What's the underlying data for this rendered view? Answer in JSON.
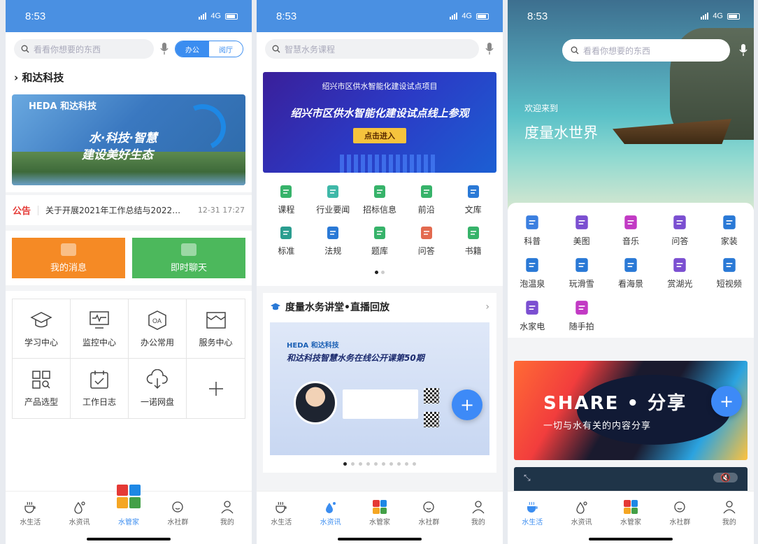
{
  "status_bar": {
    "time": "8:53",
    "network": "4G"
  },
  "tabbar": [
    {
      "label": "水生活",
      "icon": "coffee-cup-icon"
    },
    {
      "label": "水资讯",
      "icon": "water-drops-icon"
    },
    {
      "label": "水管家",
      "icon": "manager-tiles-icon"
    },
    {
      "label": "水社群",
      "icon": "chat-bubble-icon"
    },
    {
      "label": "我的",
      "icon": "person-icon"
    }
  ],
  "colors": {
    "accent": "#3b8df0",
    "orange": "#f58a25",
    "green": "#4cb85c",
    "alert": "#e53935"
  },
  "screen1": {
    "search_placeholder": "看看你想要的东西",
    "segment": [
      "办公",
      "阅厅"
    ],
    "company": "和达科技",
    "banner": {
      "logo": "HEDA 和达科技",
      "line1": "水·科技·智慧",
      "line2": "建设美好生态"
    },
    "notice": {
      "tag": "公告",
      "text": "关于开展2021年工作总结与2022…",
      "time": "12-31 17:27"
    },
    "buttons": [
      "我的消息",
      "即时聊天"
    ],
    "grid": [
      {
        "label": "学习中心",
        "icon": "graduation-cap-icon"
      },
      {
        "label": "监控中心",
        "icon": "monitor-pulse-icon"
      },
      {
        "label": "办公常用",
        "icon": "oa-hexagon-icon"
      },
      {
        "label": "服务中心",
        "icon": "service-box-icon"
      },
      {
        "label": "产品选型",
        "icon": "grid-search-icon"
      },
      {
        "label": "工作日志",
        "icon": "calendar-check-icon"
      },
      {
        "label": "一诺网盘",
        "icon": "cloud-download-icon"
      },
      {
        "label": "",
        "icon": "plus-icon"
      }
    ],
    "active_tab": 2
  },
  "screen2": {
    "search_placeholder": "智慧水务课程",
    "banner": {
      "top": "绍兴市区供水智能化建设试点项目",
      "headline": "绍兴市区供水智能化建设试点线上参观",
      "button": "点击进入"
    },
    "icons": [
      {
        "label": "课程",
        "icon": "book-icon",
        "color": "#37b36a"
      },
      {
        "label": "行业要闻",
        "icon": "news-icon",
        "color": "#3fb8a8"
      },
      {
        "label": "招标信息",
        "icon": "bid-doc-icon",
        "color": "#37b36a"
      },
      {
        "label": "前沿",
        "icon": "frontier-icon",
        "color": "#37b36a"
      },
      {
        "label": "文库",
        "icon": "library-icon",
        "color": "#2a79d6"
      },
      {
        "label": "标准",
        "icon": "scale-icon",
        "color": "#2a9d8f"
      },
      {
        "label": "法规",
        "icon": "gavel-icon",
        "color": "#2a79d6"
      },
      {
        "label": "题库",
        "icon": "quiz-icon",
        "color": "#37b36a"
      },
      {
        "label": "问答",
        "icon": "question-icon",
        "color": "#e36a4f"
      },
      {
        "label": "书籍",
        "icon": "books-icon",
        "color": "#37b36a"
      }
    ],
    "lecture": {
      "title": "度量水务讲堂•直播回放",
      "card_brand": "HEDA 和达科技",
      "card_title": "和达科技智慧水务在线公开课第50期"
    },
    "active_tab": 1
  },
  "screen3": {
    "search_placeholder": "看看你想要的东西",
    "welcome": "欢迎来到",
    "title": "度量水世界",
    "icons": [
      {
        "label": "科普",
        "icon": "hand-tap-icon",
        "color": "#3b7fe0"
      },
      {
        "label": "美图",
        "icon": "picture-icon",
        "color": "#7b4fd1"
      },
      {
        "label": "音乐",
        "icon": "music-icon",
        "color": "#c23ac4"
      },
      {
        "label": "问答",
        "icon": "pen-doc-icon",
        "color": "#7b4fd1"
      },
      {
        "label": "家装",
        "icon": "house-icon",
        "color": "#2a79d6"
      },
      {
        "label": "泡温泉",
        "icon": "hot-spring-icon",
        "color": "#2a79d6"
      },
      {
        "label": "玩滑雪",
        "icon": "skier-icon",
        "color": "#2a79d6"
      },
      {
        "label": "看海景",
        "icon": "sea-view-icon",
        "color": "#2a79d6"
      },
      {
        "label": "赏湖光",
        "icon": "lake-icon",
        "color": "#7b4fd1"
      },
      {
        "label": "短视频",
        "icon": "clapper-icon",
        "color": "#2a79d6"
      },
      {
        "label": "水家电",
        "icon": "appliance-icon",
        "color": "#7b4fd1"
      },
      {
        "label": "随手拍",
        "icon": "camera-icon",
        "color": "#c23ac4"
      }
    ],
    "share": {
      "title": "SHARE • 分享",
      "subtitle": "一切与水有关的内容分享"
    },
    "active_tab": 0
  }
}
